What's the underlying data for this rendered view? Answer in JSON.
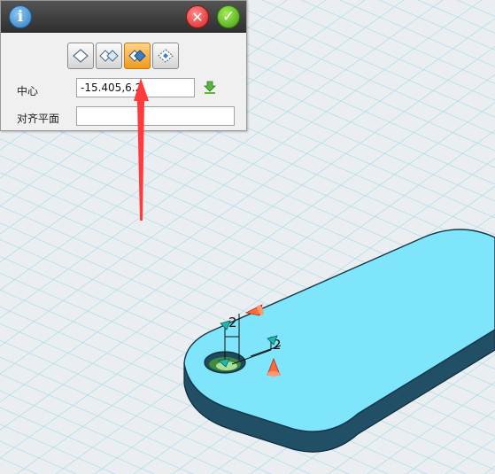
{
  "panel": {
    "buttons": {
      "info_icon": "info-icon",
      "cancel_icon": "close-icon",
      "ok_icon": "checkmark-icon"
    },
    "modes": [
      {
        "icon": "align-single-diamond-icon",
        "active": false
      },
      {
        "icon": "align-double-diamond-icon",
        "active": false
      },
      {
        "icon": "align-center-diamond-icon",
        "active": true
      },
      {
        "icon": "align-dotted-diamond-icon",
        "active": false
      }
    ],
    "center_label": "中心",
    "center_value": "-15.405,6.2",
    "align_plane_label": "对齐平面",
    "align_plane_value": ""
  },
  "viewport": {
    "part_color": "#7fe5fb",
    "part_side_color": "#214f66",
    "grid_color": "#a9dcea",
    "dimensions": {
      "vertical": "2",
      "horizontal": "2"
    }
  },
  "annotation": {
    "arrow_color": "#ff3b3b"
  }
}
